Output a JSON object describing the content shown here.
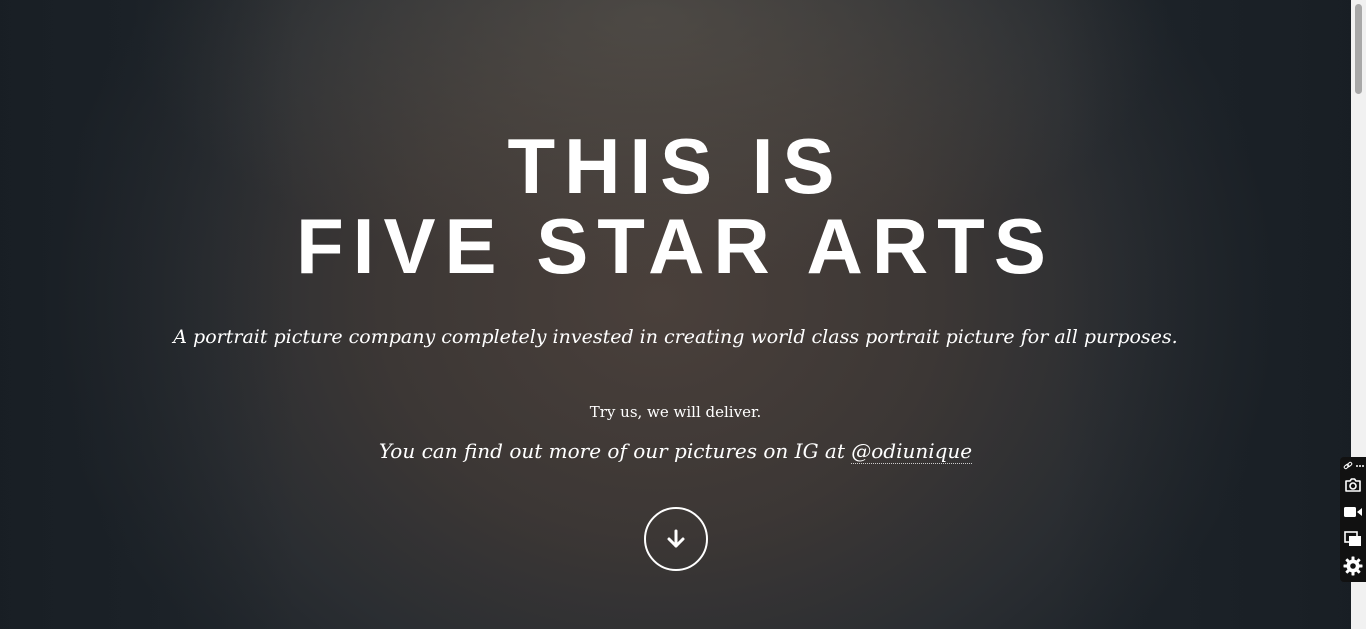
{
  "hero": {
    "title_line1": "THIS IS",
    "title_line2": "FIVE STAR ARTS",
    "subtitle": "A portrait picture company completely invested in creating world class portrait picture for all purposes.",
    "tagline": "Try us, we will deliver.",
    "ig_text": "You can find out more of our pictures on IG at ",
    "ig_handle": "@odiunique",
    "scroll_icon": "arrow-down-icon"
  },
  "side_toolbar": {
    "icons": [
      "link-icon",
      "more-icon",
      "camera-icon",
      "video-icon",
      "window-icon",
      "gear-icon"
    ]
  },
  "colors": {
    "text": "#ffffff",
    "background_dark": "#1e242a",
    "background_center": "#4a403b"
  }
}
